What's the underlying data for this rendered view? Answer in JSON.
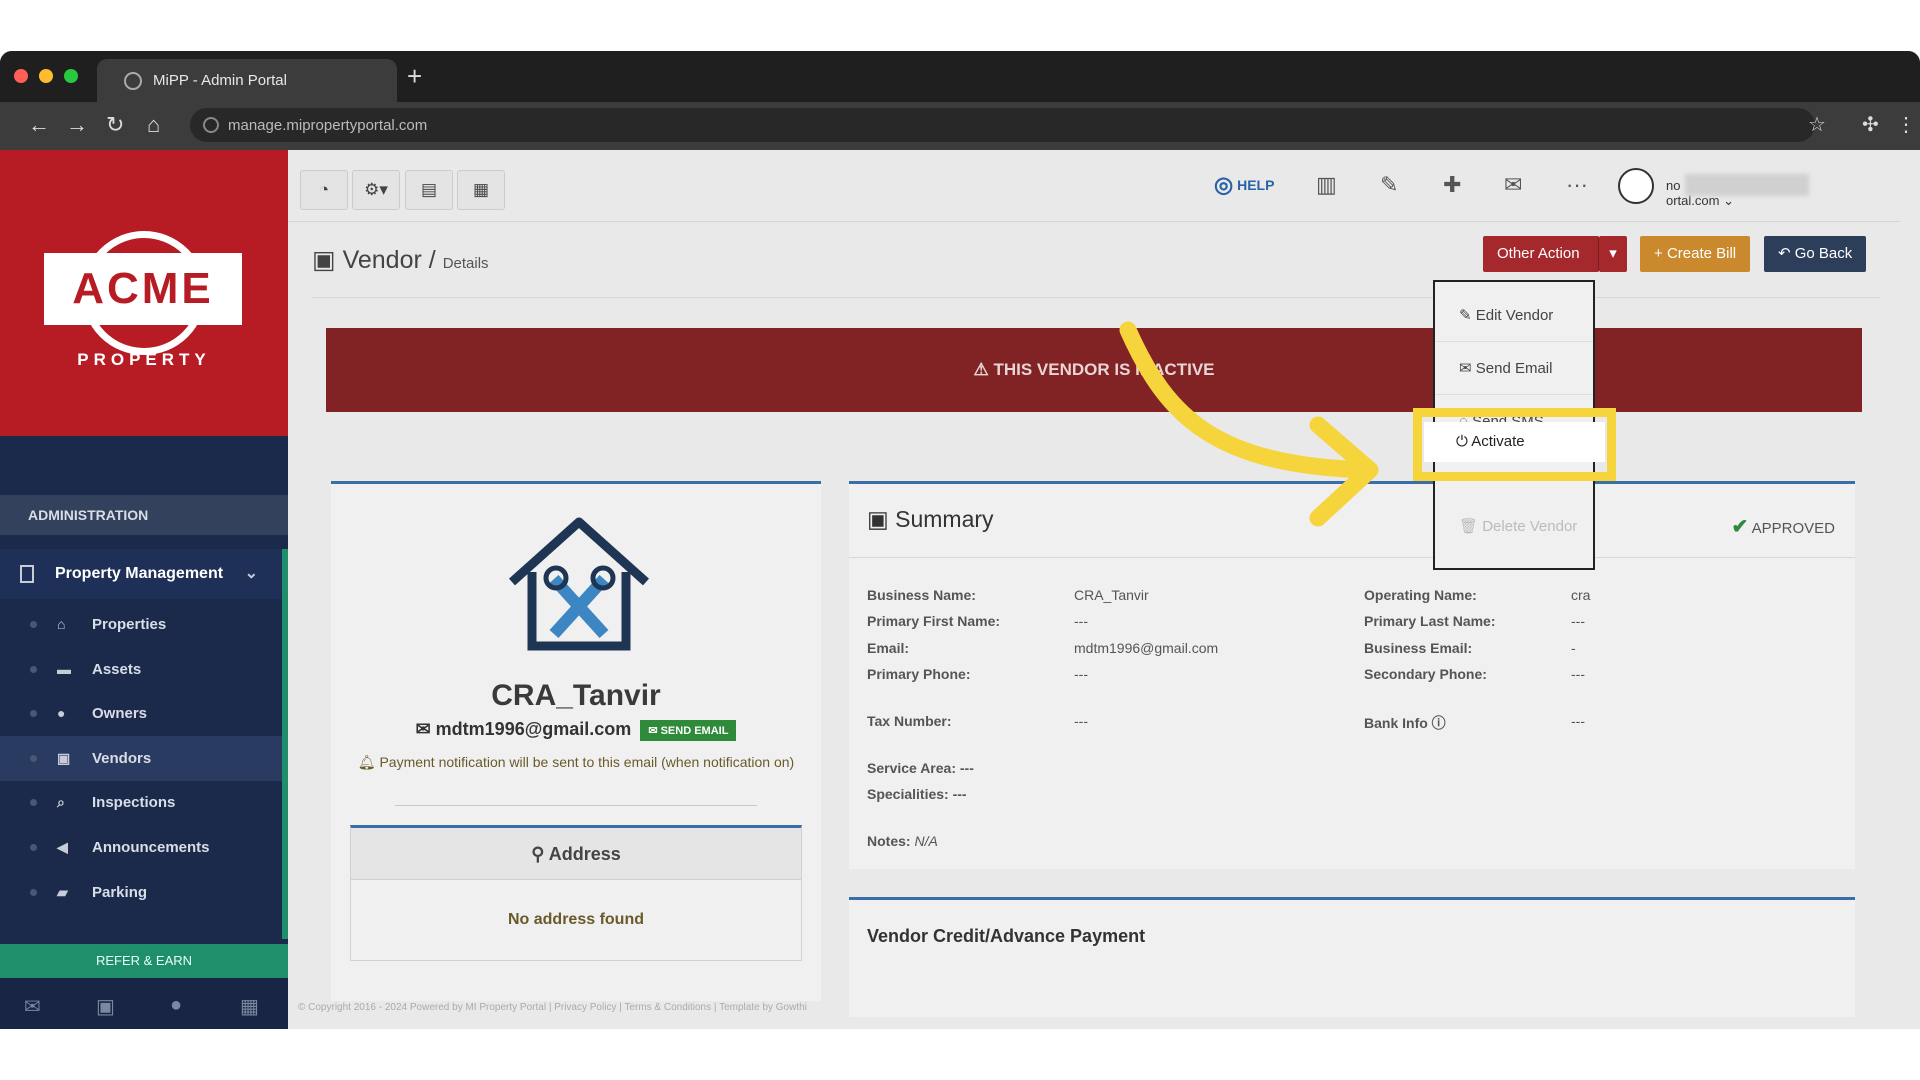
{
  "browser": {
    "tab_title": "MiPP - Admin Portal",
    "new_tab": "+",
    "url": "manage.mipropertyportal.com",
    "back_icon": "back-arrow-icon",
    "forward_icon": "forward-arrow-icon",
    "reload_icon": "reload-icon",
    "home_icon": "home-icon"
  },
  "sidebar": {
    "logo_text": "ACME",
    "logo_sub": "PROPERTY",
    "section": "ADMINISTRATION",
    "group": "Property Management",
    "items": [
      {
        "label": "Properties",
        "icon": "home-icon"
      },
      {
        "label": "Assets",
        "icon": "archive-icon"
      },
      {
        "label": "Owners",
        "icon": "user-icon"
      },
      {
        "label": "Vendors",
        "icon": "briefcase-icon"
      },
      {
        "label": "Inspections",
        "icon": "search-icon"
      },
      {
        "label": "Announcements",
        "icon": "bullhorn-icon"
      },
      {
        "label": "Parking",
        "icon": "car-icon"
      }
    ],
    "refer": "REFER & EARN"
  },
  "topbar": {
    "help": "HELP",
    "user_prefix": "no",
    "user_suffix": "ortal.com"
  },
  "header": {
    "title": "Vendor",
    "sep": "/",
    "sub": "Details",
    "other_action": "Other Action",
    "create_bill": "Create Bill",
    "go_back": "Go Back"
  },
  "banner": "THIS VENDOR IS INACTIVE",
  "dropdown": {
    "items": [
      "Edit Vendor",
      "Send Email",
      "Send SMS",
      "Activate",
      "Delete Vendor"
    ]
  },
  "profile": {
    "name": "CRA_Tanvir",
    "email": "mdtm1996@gmail.com",
    "send_email": "SEND EMAIL",
    "note": "Payment notification will be sent to this email (when notification on)",
    "address_title": "Address",
    "no_address": "No address found"
  },
  "summary": {
    "title": "Summary",
    "status": "APPROVED",
    "left_labels": [
      "Business Name:",
      "Primary First Name:",
      "Email:",
      "Primary Phone:",
      "Tax Number:"
    ],
    "left_values": [
      "CRA_Tanvir",
      "---",
      "mdtm1996@gmail.com",
      "---",
      "---"
    ],
    "right_labels": [
      "Operating Name:",
      "Primary Last Name:",
      "Business Email:",
      "Secondary Phone:",
      "Bank Info"
    ],
    "right_values": [
      "cra",
      "---",
      "-",
      "---",
      "---"
    ],
    "service_area": "Service Area: ---",
    "specialities": "Specialities: ---",
    "notes_label": "Notes:",
    "notes_value": "N/A"
  },
  "credit_title": "Vendor Credit/Advance Payment",
  "footer": "© Copyright 2016 - 2024 Powered by MI Property Portal | Privacy Policy | Terms & Conditions | Template by Gowthi",
  "colors": {
    "brand_red": "#b71c24",
    "sidebar": "#1b2a4b",
    "highlight": "#f5d53b",
    "banner": "#812224"
  }
}
